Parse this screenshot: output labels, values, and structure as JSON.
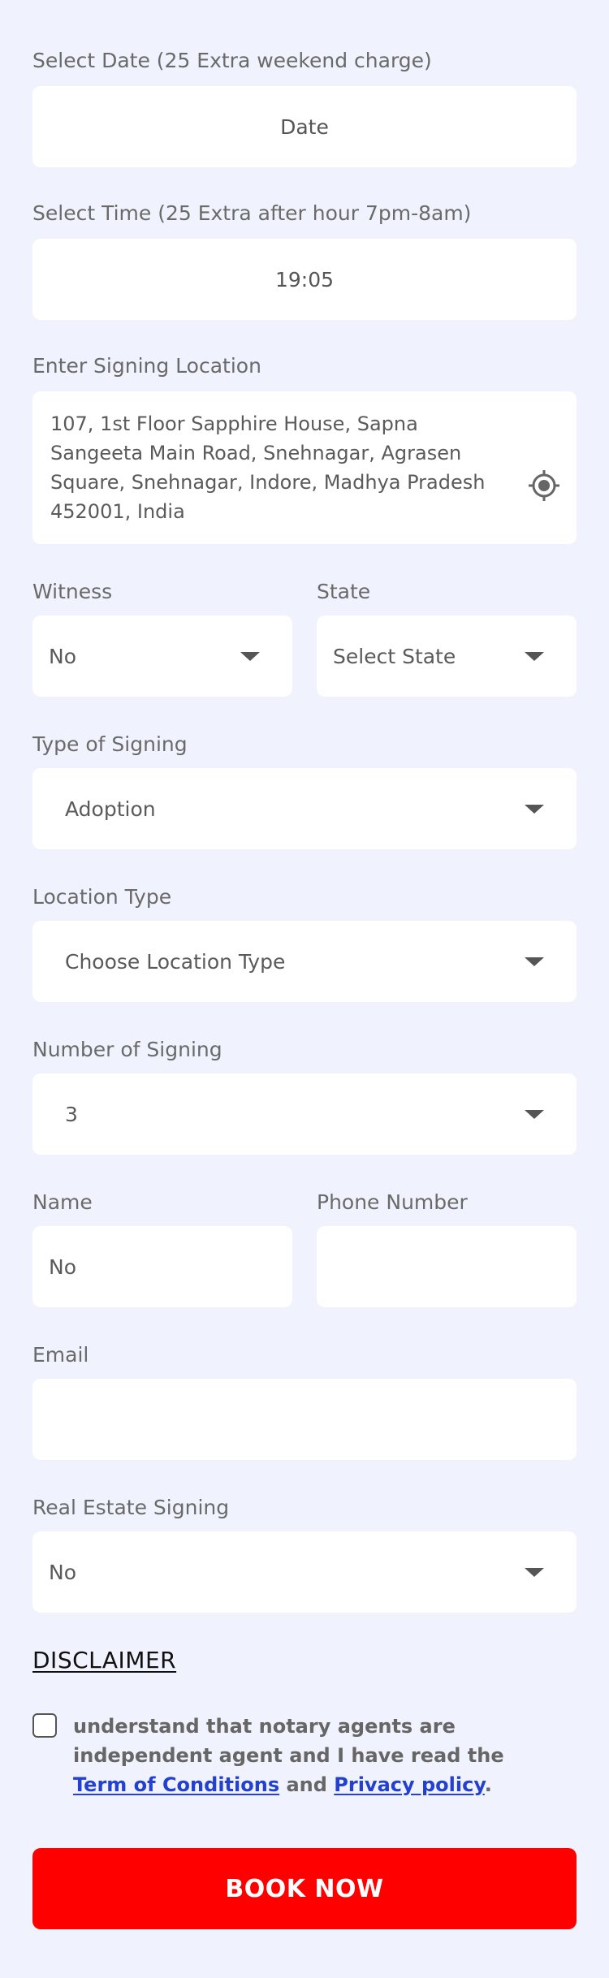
{
  "date": {
    "label": "Select Date (25 Extra weekend charge)",
    "placeholder": "Date"
  },
  "time": {
    "label": "Select Time (25 Extra after hour 7pm-8am)",
    "value": "19:05"
  },
  "location": {
    "label": "Enter Signing Location",
    "value": "107, 1st Floor Sapphire House, Sapna Sangeeta Main Road, Snehnagar, Agrasen Square, Snehnagar, Indore, Madhya Pradesh 452001, India",
    "icon": "location-target-icon"
  },
  "witness": {
    "label": "Witness",
    "value": "No"
  },
  "state": {
    "label": "State",
    "value": "Select State"
  },
  "signing_type": {
    "label": "Type of Signing",
    "value": "Adoption"
  },
  "location_type": {
    "label": "Location Type",
    "value": "Choose Location Type"
  },
  "number_of_signing": {
    "label": "Number of Signing",
    "value": "3"
  },
  "name": {
    "label": "Name",
    "value": "No"
  },
  "phone": {
    "label": "Phone Number",
    "value": ""
  },
  "email": {
    "label": "Email",
    "value": ""
  },
  "real_estate": {
    "label": "Real Estate Signing",
    "value": "No"
  },
  "disclaimer": {
    "title": "DISCLAIMER",
    "text_before": "understand that notary agents are independent agent and I have read the ",
    "terms_link": "Term of Conditions",
    "text_middle": " and ",
    "privacy_link": "Privacy policy",
    "text_after": "."
  },
  "book_button": "BOOK NOW",
  "colors": {
    "background": "#f0f3fd",
    "button": "#ff0000",
    "link": "#2340d0"
  }
}
